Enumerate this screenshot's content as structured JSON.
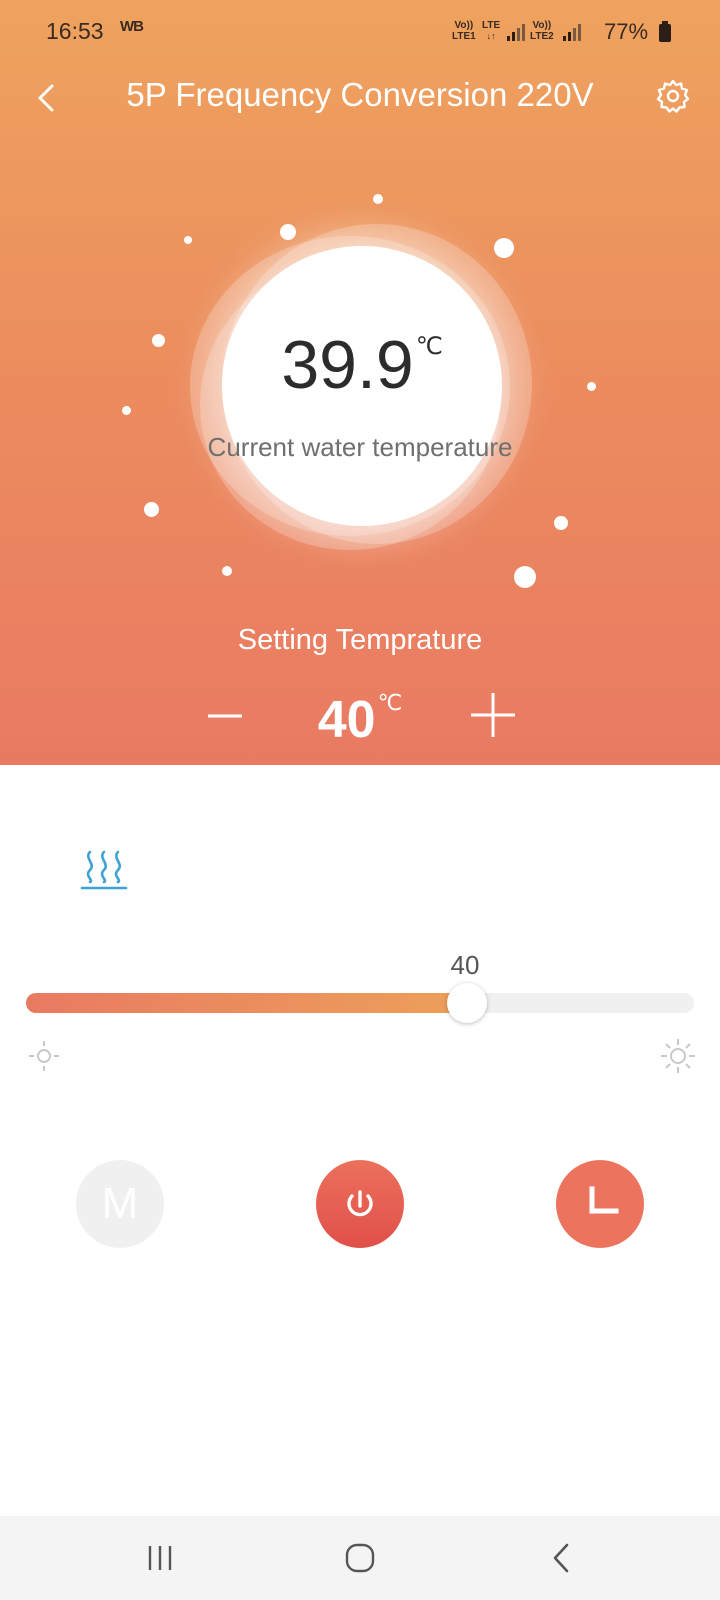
{
  "status_bar": {
    "time": "16:53",
    "app_badge": "WB",
    "sim1_top": "Vo))",
    "sim1_bottom": "LTE1",
    "net_top": "LTE",
    "sim2_top": "Vo))",
    "sim2_bottom": "LTE2",
    "battery": "77%"
  },
  "header": {
    "title": "5P Frequency Conversion 220V",
    "back_icon": "chevron-left-icon",
    "settings_icon": "gear-icon"
  },
  "current": {
    "value": "39.9",
    "unit": "℃",
    "label": "Current water temperature"
  },
  "setting": {
    "label": "Setting Temprature",
    "value": "40",
    "unit": "℃",
    "minus_icon": "minus-icon",
    "plus_icon": "plus-icon"
  },
  "heating": {
    "icon": "heat-waves-icon"
  },
  "slider": {
    "value_label": "40",
    "level": 0.66,
    "low_icon": "sun-dim-icon",
    "high_icon": "sun-bright-icon"
  },
  "controls": {
    "mode_label": "M",
    "power_icon": "power-icon",
    "timer_icon": "clock-icon"
  },
  "nav_bar": {
    "recents_icon": "recents-icon",
    "home_icon": "home-icon",
    "back_icon": "back-icon"
  },
  "colors": {
    "gradient_top": "#eea35e",
    "gradient_bottom": "#e97a62",
    "accent": "#ec745e",
    "heat_icon": "#3ea2d6"
  }
}
